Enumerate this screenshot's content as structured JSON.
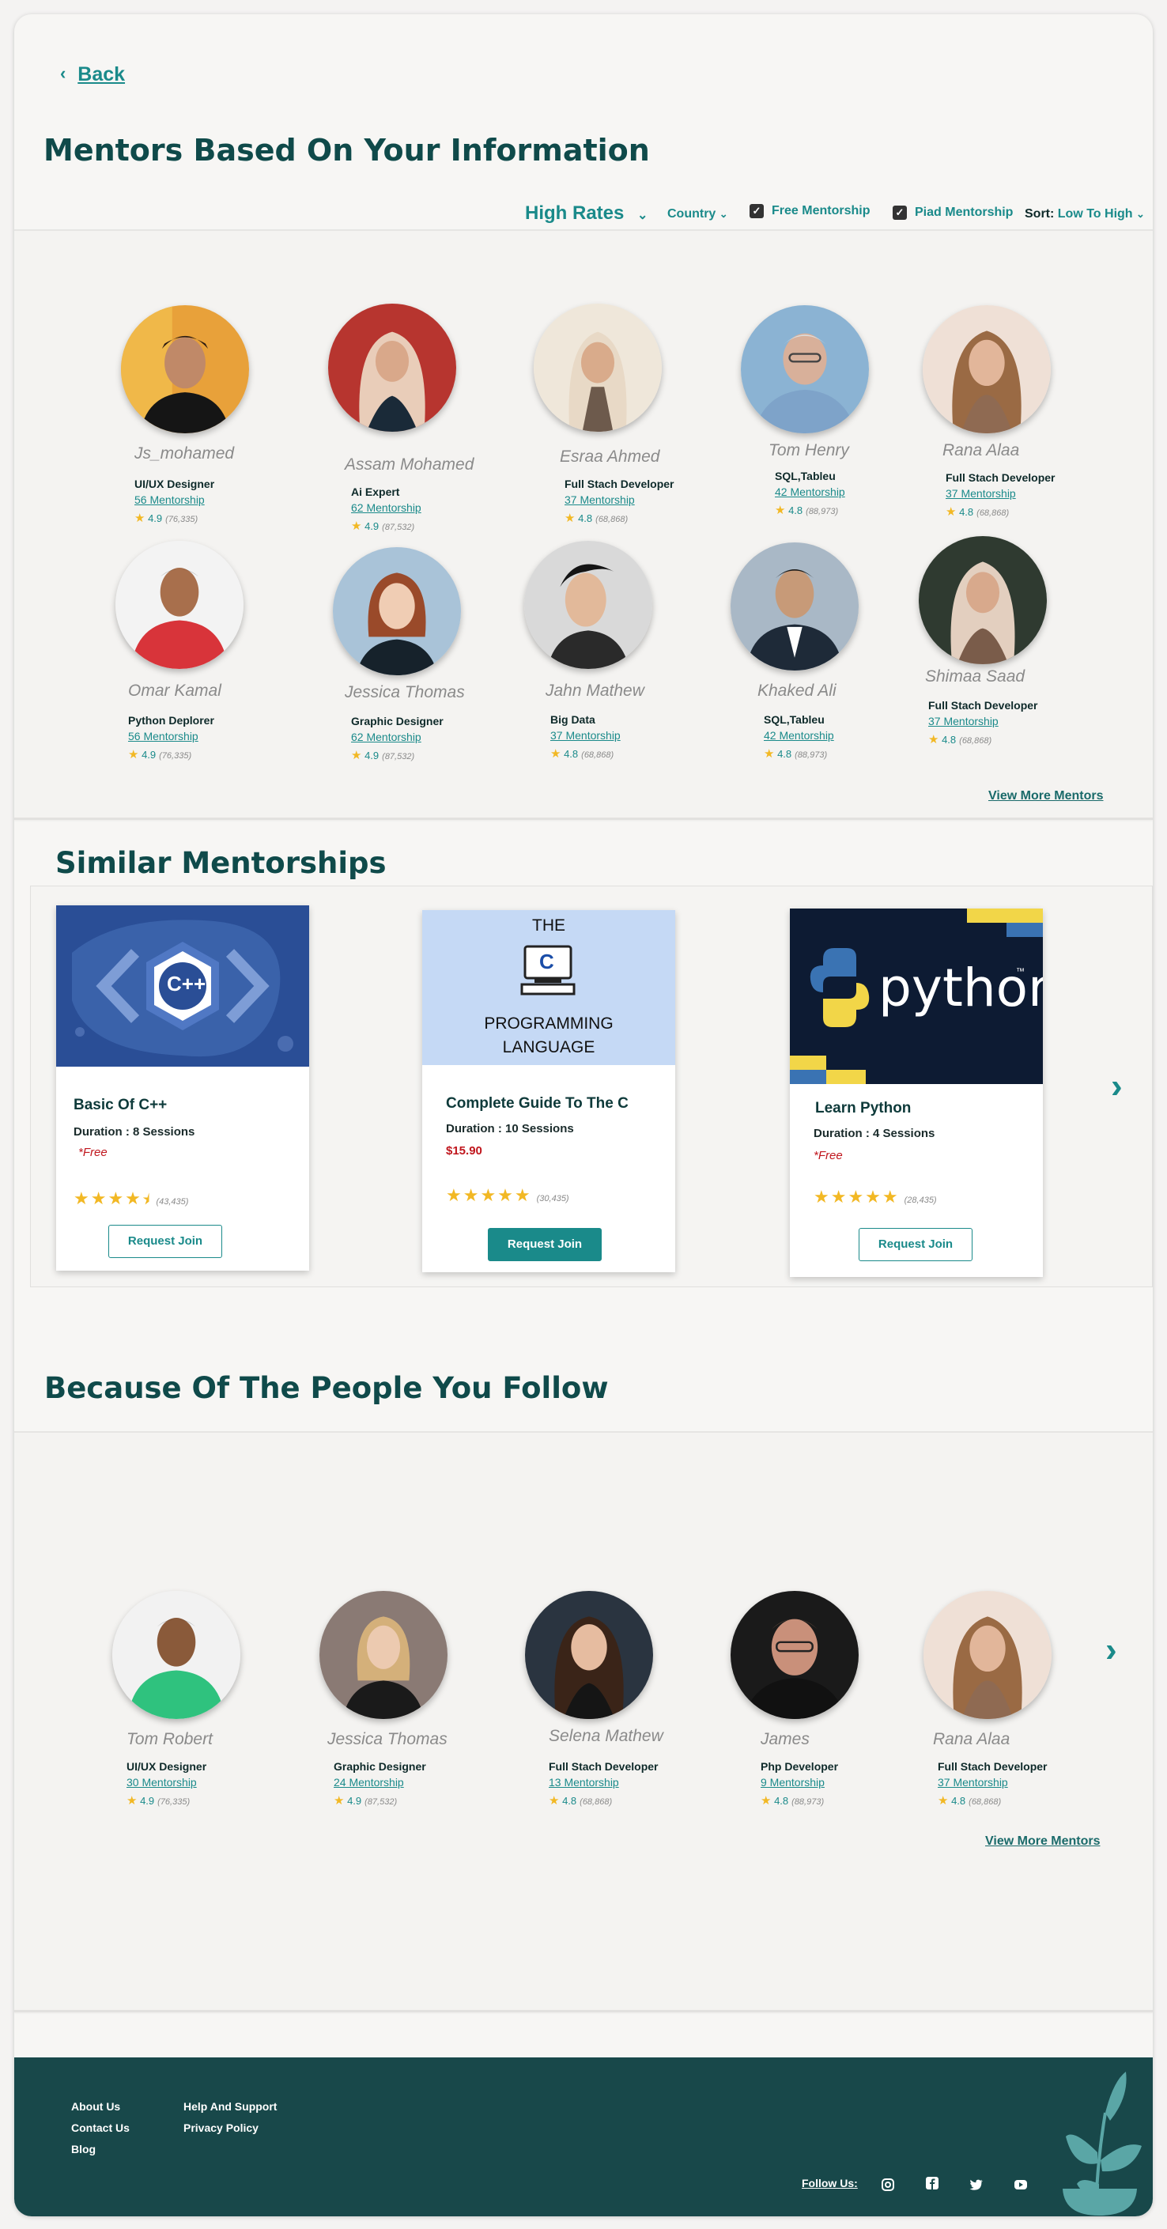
{
  "nav": {
    "back_label": "Back"
  },
  "page_title": "Mentors Based On Your Information",
  "filters": {
    "rates_label": "High Rates",
    "country_label": "Country",
    "free_label": "Free Mentorship",
    "paid_label": "Piad Mentorship",
    "sort_prefix": "Sort:",
    "sort_value": "Low To High"
  },
  "mentors": [
    {
      "name": "Js_mohamed",
      "role": "UI/UX Designer",
      "mentorship": "56 Mentorship",
      "rating": "4.9",
      "count": "(76,335)"
    },
    {
      "name": "Assam Mohamed",
      "role": "Ai Expert",
      "mentorship": "62 Mentorship",
      "rating": "4.9",
      "count": "(87,532)"
    },
    {
      "name": "Esraa Ahmed",
      "role": "Full Stach Developer",
      "mentorship": "37 Mentorship",
      "rating": "4.8",
      "count": "(68,868)"
    },
    {
      "name": "Tom  Henry",
      "role": "SQL,Tableu",
      "mentorship": "42 Mentorship",
      "rating": "4.8",
      "count": "(88,973)"
    },
    {
      "name": "Rana Alaa",
      "role": "Full Stach Developer",
      "mentorship": "37 Mentorship",
      "rating": "4.8",
      "count": "(68,868)"
    },
    {
      "name": "Omar Kamal",
      "role": "Python Deplorer",
      "mentorship": "56 Mentorship",
      "rating": "4.9",
      "count": "(76,335)"
    },
    {
      "name": "Jessica Thomas",
      "role": "Graphic Designer",
      "mentorship": "62 Mentorship",
      "rating": "4.9",
      "count": "(87,532)"
    },
    {
      "name": "Jahn Mathew",
      "role": "Big Data",
      "mentorship": "37 Mentorship",
      "rating": "4.8",
      "count": "(68,868)"
    },
    {
      "name": "Khaked Ali",
      "role": "SQL,Tableu",
      "mentorship": "42 Mentorship",
      "rating": "4.8",
      "count": "(88,973)"
    },
    {
      "name": "Shimaa Saad",
      "role": "Full Stach Developer",
      "mentorship": "37 Mentorship",
      "rating": "4.8",
      "count": "(68,868)"
    }
  ],
  "view_more_label": "View More Mentors",
  "similar_title": "Similar Mentorships",
  "courses": [
    {
      "title": "Basic Of C++",
      "duration": "Duration : 8 Sessions",
      "price": "*Free",
      "count": "(43,435)",
      "button": "Request Join",
      "thumb_text": "C++"
    },
    {
      "title": "Complete Guide To The C",
      "duration": "Duration : 10 Sessions",
      "price": "$15.90",
      "count": "(30,435)",
      "button": "Request Join",
      "thumb_line1": "THE",
      "thumb_letter": "C",
      "thumb_line2": "PROGRAMMING",
      "thumb_line3": "LANGUAGE"
    },
    {
      "title": "Learn Python",
      "duration": "Duration : 4 Sessions",
      "price": "*Free",
      "count": "(28,435)",
      "button": "Request Join",
      "thumb_text": "python",
      "thumb_tm": "™"
    }
  ],
  "follow_title": "Because Of The People You Follow",
  "follow_mentors": [
    {
      "name": "Tom Robert",
      "role": "UI/UX Designer",
      "mentorship": "30  Mentorship",
      "rating": "4.9",
      "count": "(76,335)"
    },
    {
      "name": "Jessica Thomas",
      "role": "Graphic Designer",
      "mentorship": "24 Mentorship",
      "rating": "4.9",
      "count": "(87,532)"
    },
    {
      "name": "Selena Mathew",
      "role": "Full Stach Developer",
      "mentorship": "13 Mentorship",
      "rating": "4.8",
      "count": "(68,868)"
    },
    {
      "name": "James",
      "role": "Php Developer",
      "mentorship": "9 Mentorship",
      "rating": "4.8",
      "count": "(88,973)"
    },
    {
      "name": "Rana Alaa",
      "role": "Full Stach Developer",
      "mentorship": "37 Mentorship",
      "rating": "4.8",
      "count": "(68,868)"
    }
  ],
  "footer": {
    "about": "About Us",
    "contact": "Contact Us",
    "blog": "Blog",
    "help": "Help And Support",
    "privacy": "Privacy Policy",
    "follow": "Follow Us:"
  },
  "colors": {
    "accent": "#1a8a8a",
    "heading": "#0f4a4a",
    "footer": "#18484a",
    "star": "#f2b824",
    "price": "#c0161d"
  }
}
